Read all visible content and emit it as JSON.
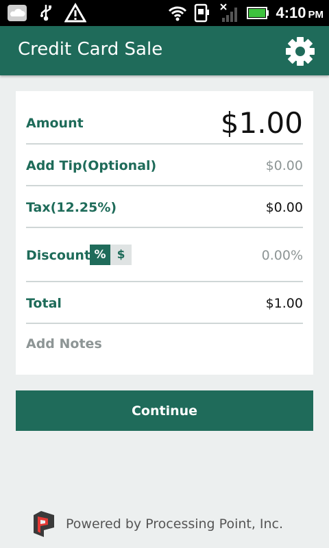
{
  "status_bar": {
    "time": "4:10",
    "ampm": "PM",
    "left_icons": [
      "cloud-icon",
      "usb-icon",
      "warning-icon"
    ],
    "right_icons": [
      "wifi-icon",
      "sim-icon",
      "signal-off-icon",
      "battery-icon"
    ]
  },
  "header": {
    "title": "Credit Card Sale",
    "settings_icon": "gear-icon"
  },
  "form": {
    "amount": {
      "label": "Amount",
      "value": "$1.00"
    },
    "tip": {
      "label": "Add Tip(Optional)",
      "value": "$0.00"
    },
    "tax": {
      "label": "Tax(12.25%)",
      "value": "$0.00"
    },
    "discount": {
      "label": "Discount",
      "percent_label": "%",
      "dollar_label": "$",
      "selected": "%",
      "value": "0.00%"
    },
    "total": {
      "label": "Total",
      "value": "$1.00"
    },
    "notes": {
      "label": "Add Notes"
    }
  },
  "actions": {
    "continue_label": "Continue"
  },
  "footer": {
    "powered_by": "Powered by Processing Point, Inc."
  },
  "colors": {
    "brand": "#1f6b5a",
    "label_green": "#1e6b59",
    "background": "#ecefef",
    "muted_text": "#8d9595"
  }
}
